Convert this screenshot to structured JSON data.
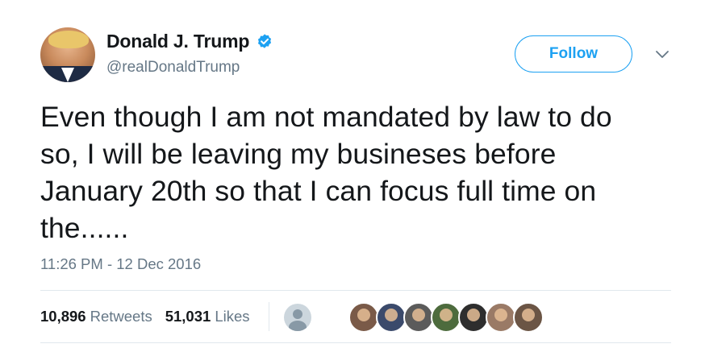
{
  "user": {
    "display_name": "Donald J. Trump",
    "handle": "@realDonaldTrump",
    "verified": true
  },
  "follow_label": "Follow",
  "tweet": {
    "lines": [
      "Even though I am not mandated by law to do",
      "so, I will be leaving my busineses before",
      "January 20th so that I can focus full time on",
      "the......"
    ],
    "timestamp": "11:26 PM - 12 Dec 2016"
  },
  "stats": {
    "retweets_count": "10,896",
    "retweets_label": "Retweets",
    "likes_count": "51,031",
    "likes_label": "Likes"
  },
  "colors": {
    "accent": "#1da1f2",
    "secondary_text": "#657786",
    "divider": "#e1e8ed"
  },
  "liker_avatar_colors": [
    "#7a5a48",
    "#3b4a6b",
    "#5b5b5b",
    "#4d6b3d",
    "#2e2e2e",
    "#9a7a66",
    "#6b5545"
  ]
}
